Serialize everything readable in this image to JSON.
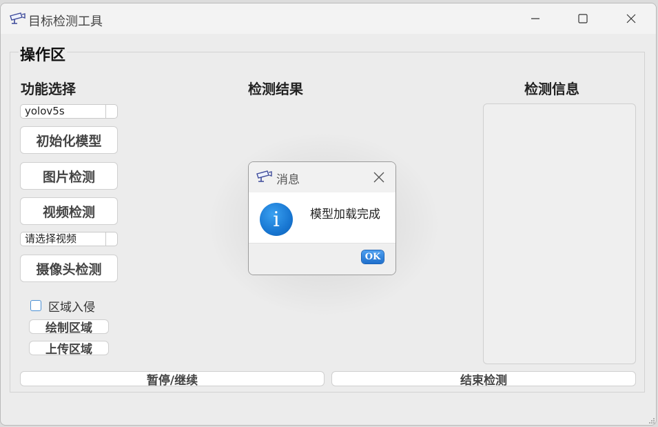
{
  "window": {
    "title": "目标检测工具",
    "controls": {
      "minimize": "minimize-icon",
      "maximize": "maximize-icon",
      "close": "close-icon"
    }
  },
  "group": {
    "title": "操作区"
  },
  "left_panel": {
    "title": "功能选择",
    "model_select": {
      "value": "yolov5s"
    },
    "init_button": "初始化模型",
    "image_button": "图片检测",
    "video_button": "视频检测",
    "video_select": {
      "value": "请选择视频"
    },
    "camera_button": "摄像头检测",
    "intrusion_checkbox": {
      "label": "区域入侵",
      "checked": false
    },
    "draw_area_button": "绘制区域",
    "upload_area_button": "上传区域"
  },
  "center_panel": {
    "title": "检测结果"
  },
  "right_panel": {
    "title": "检测信息"
  },
  "bottom": {
    "pause_button": "暂停/继续",
    "stop_button": "结束检测"
  },
  "dialog": {
    "title": "消息",
    "message": "模型加载完成",
    "ok_label": "OK",
    "icon": "info-icon"
  },
  "colors": {
    "accent": "#1877d2",
    "checkbox_border": "#4a8fd3"
  }
}
